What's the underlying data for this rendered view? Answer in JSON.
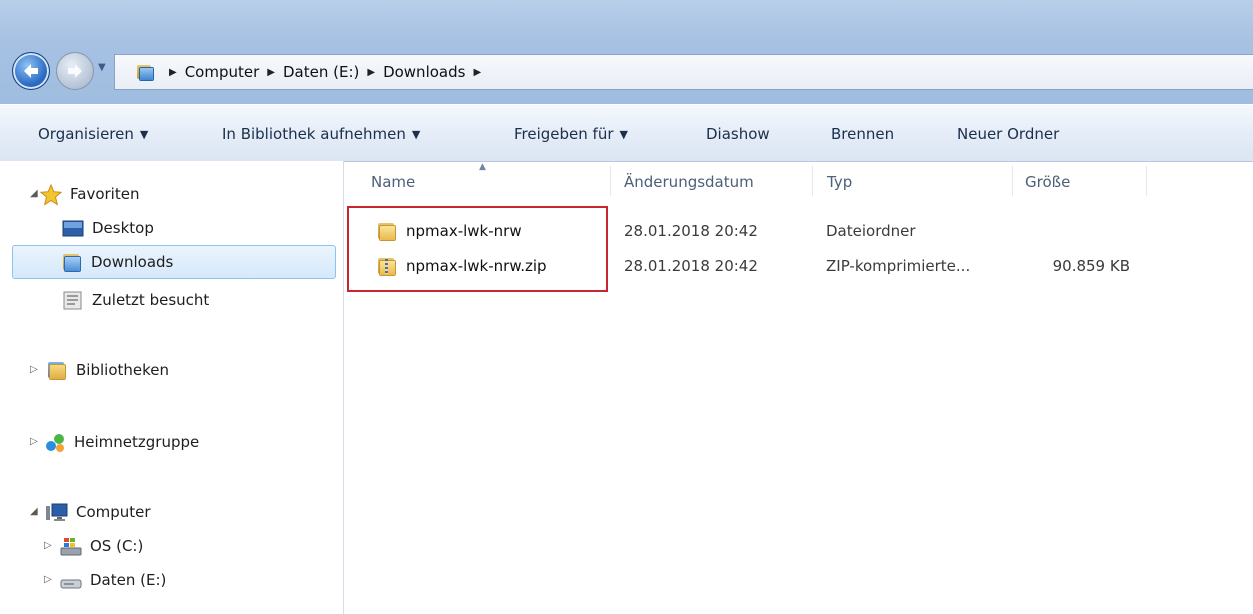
{
  "address": {
    "crumbs": [
      "Computer",
      "Daten (E:)",
      "Downloads"
    ]
  },
  "toolbar": {
    "organize": "Organisieren",
    "add_to_library": "In Bibliothek aufnehmen",
    "share_with": "Freigeben für",
    "slideshow": "Diashow",
    "burn": "Brennen",
    "new_folder": "Neuer Ordner"
  },
  "nav": {
    "favorites": "Favoriten",
    "desktop": "Desktop",
    "downloads": "Downloads",
    "recent": "Zuletzt besucht",
    "libraries": "Bibliotheken",
    "homegroup": "Heimnetzgruppe",
    "computer": "Computer",
    "drive_c": "OS (C:)",
    "drive_e": "Daten (E:)"
  },
  "columns": {
    "name": "Name",
    "date": "Änderungsdatum",
    "type": "Typ",
    "size": "Größe"
  },
  "files": [
    {
      "name": "npmax-lwk-nrw",
      "date": "28.01.2018 20:42",
      "type": "Dateiordner",
      "size": ""
    },
    {
      "name": "npmax-lwk-nrw.zip",
      "date": "28.01.2018 20:42",
      "type": "ZIP-komprimierte...",
      "size": "90.859 KB"
    }
  ],
  "colors": {
    "selection_border": "#8ec2ef",
    "highlight_border": "#c8252e",
    "titlebar": "#a6c1e2"
  }
}
